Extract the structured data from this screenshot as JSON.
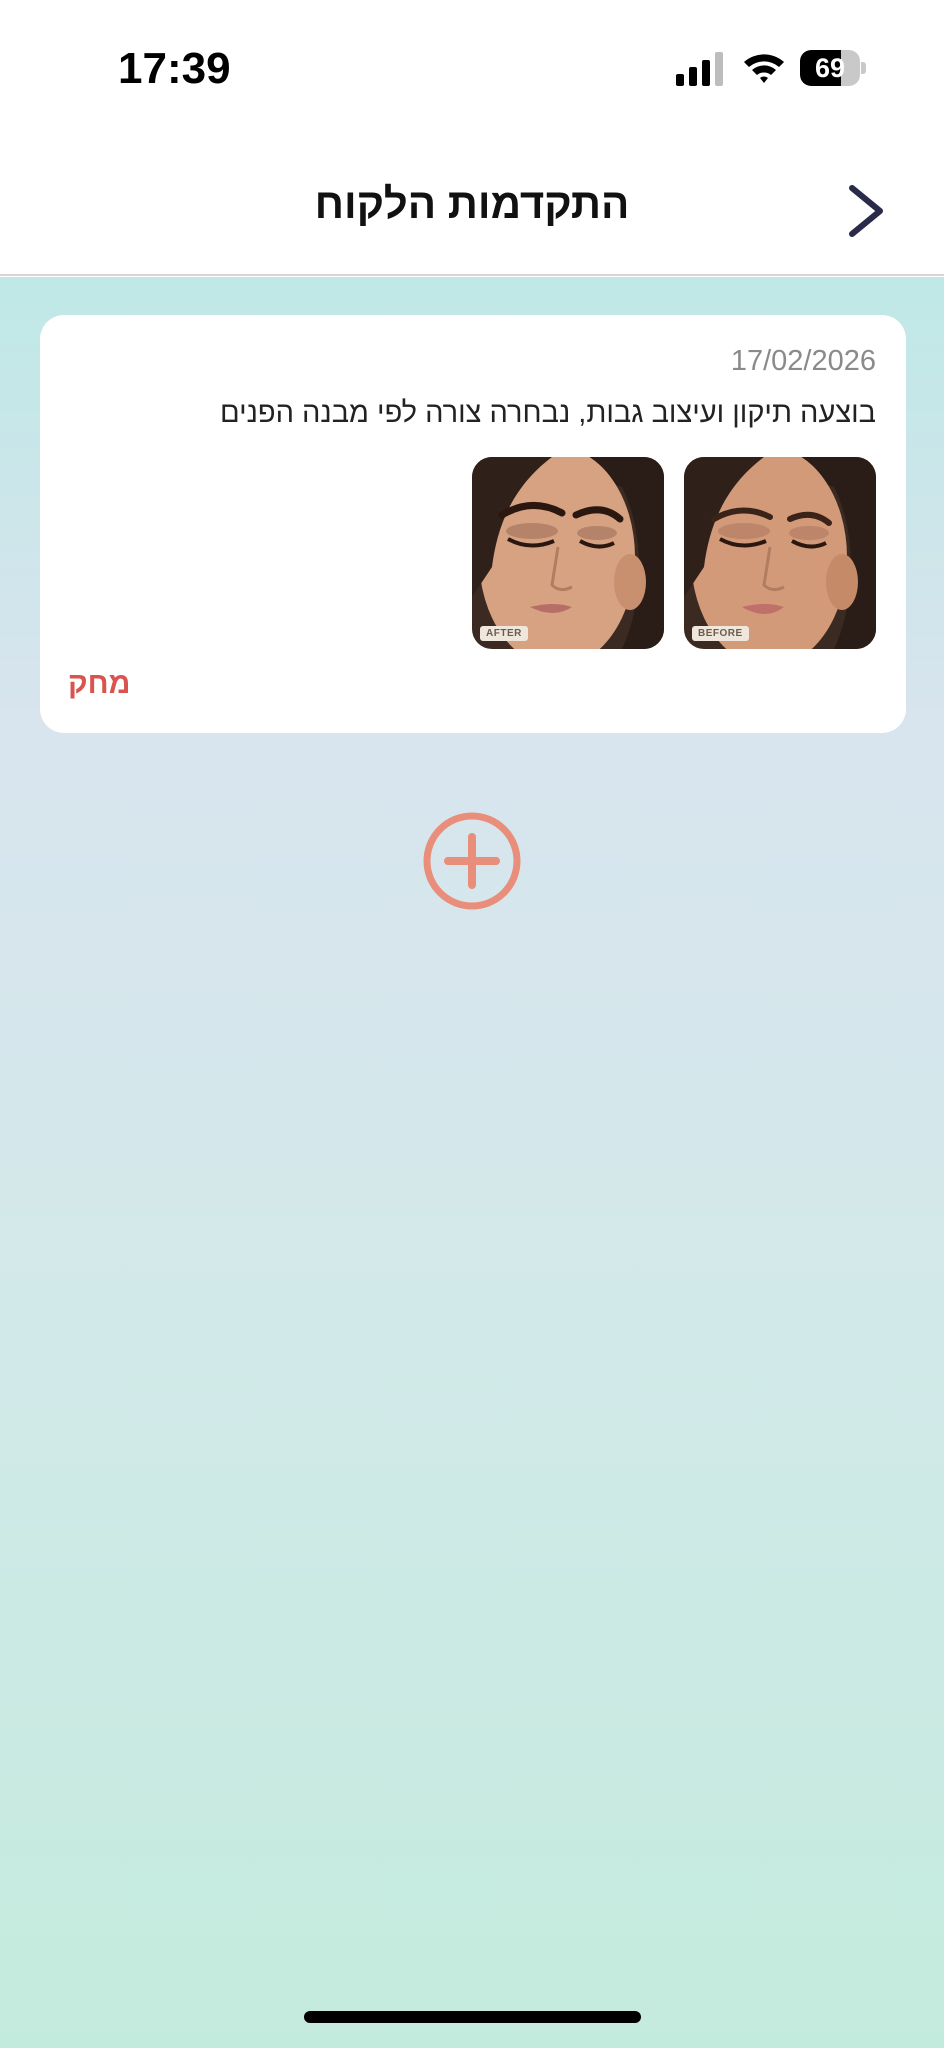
{
  "status_bar": {
    "time": "17:39",
    "battery_level": "69",
    "battery_fraction": 0.69,
    "icons": [
      "signal-icon",
      "wifi-icon",
      "battery-icon"
    ]
  },
  "header": {
    "title": "התקדמות הלקוח",
    "back_icon": "chevron-right-icon"
  },
  "progress_entries": [
    {
      "date": "17/02/2026",
      "description": "בוצעה תיקון ועיצוב גבות, נבחרה צורה לפי מבנה הפנים",
      "photos": [
        {
          "label": "BEFORE"
        },
        {
          "label": "AFTER"
        }
      ],
      "delete_label": "מחק"
    }
  ],
  "add_button_icon": "plus-circle-icon",
  "colors": {
    "accent": "#e88e7a",
    "delete": "#d9534f",
    "gradient_top": "#bfe8e6",
    "gradient_bottom": "#c3ebdd"
  }
}
